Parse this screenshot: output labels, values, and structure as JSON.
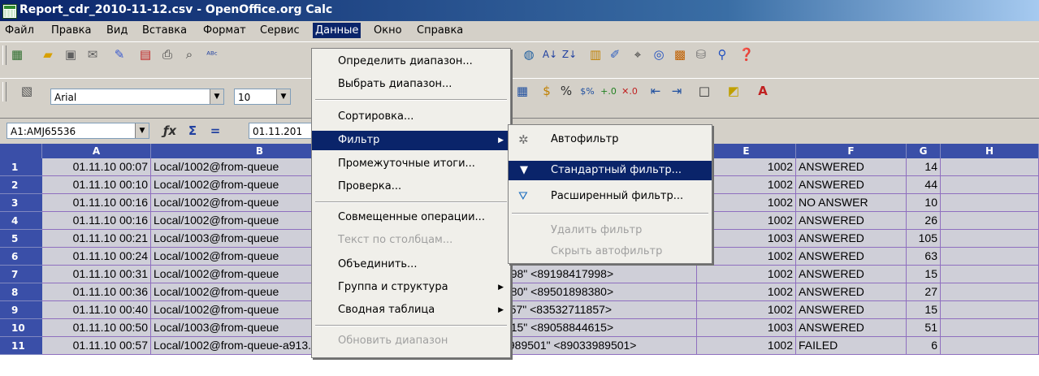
{
  "window": {
    "title": "Report_cdr_2010-11-12.csv - OpenOffice.org Calc"
  },
  "menubar": [
    "Файл",
    "Правка",
    "Вид",
    "Вставка",
    "Формат",
    "Сервис",
    "Данные",
    "Окно",
    "Справка"
  ],
  "toolbar2": {
    "font_name": "Arial",
    "font_size": "10"
  },
  "formula": {
    "name_box": "A1:AMJ65536",
    "input": "01.11.201"
  },
  "columns": [
    "A",
    "B",
    "E",
    "F",
    "G",
    "H"
  ],
  "rows": [
    {
      "n": "1",
      "a": "01.11.10 00:07",
      "b": "Local/1002@from-queue",
      "d": "",
      "e": "1002",
      "f": "ANSWERED",
      "g": "14"
    },
    {
      "n": "2",
      "a": "01.11.10 00:10",
      "b": "Local/1002@from-queue",
      "d": "",
      "e": "1002",
      "f": "ANSWERED",
      "g": "44"
    },
    {
      "n": "3",
      "a": "01.11.10 00:16",
      "b": "Local/1002@from-queue",
      "d": "",
      "e": "1002",
      "f": "NO ANSWER",
      "g": "10"
    },
    {
      "n": "4",
      "a": "01.11.10 00:16",
      "b": "Local/1002@from-queue",
      "d": "",
      "e": "1002",
      "f": "ANSWERED",
      "g": "26"
    },
    {
      "n": "5",
      "a": "01.11.10 00:21",
      "b": "Local/1003@from-queue",
      "d": "",
      "e": "1003",
      "f": "ANSWERED",
      "g": "105"
    },
    {
      "n": "6",
      "a": "01.11.10 00:24",
      "b": "Local/1002@from-queue",
      "d": "25345136\" <89225345136>",
      "e": "1002",
      "f": "ANSWERED",
      "g": "63"
    },
    {
      "n": "7",
      "a": "01.11.10 00:31",
      "b": "Local/1002@from-queue",
      "d": "98417998\" <89198417998>",
      "e": "1002",
      "f": "ANSWERED",
      "g": "15"
    },
    {
      "n": "8",
      "a": "01.11.10 00:36",
      "b": "Local/1002@from-queue",
      "d": "01898380\" <89501898380>",
      "e": "1002",
      "f": "ANSWERED",
      "g": "27"
    },
    {
      "n": "9",
      "a": "01.11.10 00:40",
      "b": "Local/1002@from-queue",
      "d": "32711857\" <83532711857>",
      "e": "1002",
      "f": "ANSWERED",
      "g": "15"
    },
    {
      "n": "10",
      "a": "01.11.10 00:50",
      "b": "Local/1003@from-queue",
      "d": "58844615\" <89058844615>",
      "e": "1003",
      "f": "ANSWERED",
      "g": "51"
    },
    {
      "n": "11",
      "a": "01.11.10 00:57",
      "b": "Local/1002@from-queue-a913.2",
      "c": "89033989501",
      "d": "\"89033989501\" <89033989501>",
      "e": "1002",
      "f": "FAILED",
      "g": "6"
    }
  ],
  "data_menu": {
    "items": [
      "Определить диапазон...",
      "Выбрать диапазон...",
      "Сортировка...",
      "Фильтр",
      "Промежуточные итоги...",
      "Проверка...",
      "Совмещенные операции...",
      "Текст по столбцам...",
      "Объединить...",
      "Группа и структура",
      "Сводная таблица",
      "Обновить диапазон"
    ]
  },
  "filter_submenu": {
    "items": [
      "Автофильтр",
      "Стандартный фильтр...",
      "Расширенный фильтр...",
      "Удалить фильтр",
      "Скрыть автофильтр"
    ]
  },
  "colors": {
    "title_start": "#0a246a",
    "highlight": "#0a246a",
    "header_blue": "#3a4fa8",
    "cell_bg": "#cfcfd8"
  }
}
